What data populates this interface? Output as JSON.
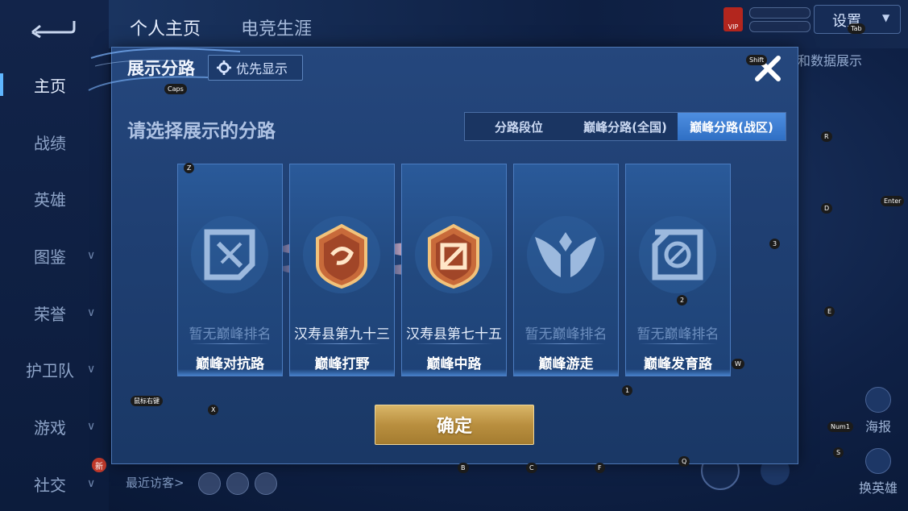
{
  "sidebar": {
    "items": [
      {
        "label": "主页",
        "chevron": false
      },
      {
        "label": "战绩",
        "chevron": false
      },
      {
        "label": "英雄",
        "chevron": false
      },
      {
        "label": "图鉴",
        "chevron": true
      },
      {
        "label": "荣誉",
        "chevron": true
      },
      {
        "label": "护卫队",
        "chevron": true
      },
      {
        "label": "游戏",
        "chevron": true
      },
      {
        "label": "社交",
        "chevron": true
      }
    ],
    "new_badge": "新"
  },
  "top_tabs": [
    "个人主页",
    "电竞生涯"
  ],
  "header": {
    "vip_label": "VIP",
    "settings_label": "设置"
  },
  "right_panel": {
    "label": "和数据展示",
    "poster_label": "海报",
    "swap_label": "换英雄"
  },
  "recent_visitors": "最近访客>",
  "dialog": {
    "title": "展示分路",
    "priority_label": "优先显示",
    "subtitle": "请选择展示的分路",
    "segments": [
      "分路段位",
      "巅峰分路(全国)",
      "巅峰分路(战区)"
    ],
    "active_segment": 2,
    "cards": [
      {
        "rank": "暂无巅峰排名",
        "role": "巅峰对抗路",
        "ranked": false,
        "icon": "lane-top-icon"
      },
      {
        "rank": "汉寿县第九十三",
        "role": "巅峰打野",
        "ranked": true,
        "icon": "lane-jungle-badge-icon"
      },
      {
        "rank": "汉寿县第七十五",
        "role": "巅峰中路",
        "ranked": true,
        "icon": "lane-mid-badge-icon"
      },
      {
        "rank": "暂无巅峰排名",
        "role": "巅峰游走",
        "ranked": false,
        "icon": "lane-support-icon"
      },
      {
        "rank": "暂无巅峰排名",
        "role": "巅峰发育路",
        "ranked": false,
        "icon": "lane-bottom-icon"
      }
    ],
    "confirm_label": "确定"
  },
  "key_hints": {
    "caps": "Caps",
    "shift": "Shift",
    "tab": "Tab",
    "r": "R",
    "enter": "Enter",
    "d": "D",
    "three": "3",
    "e": "E",
    "two": "2",
    "w": "W",
    "one": "1",
    "z": "Z",
    "x": "X",
    "num1": "Num1",
    "s": "S",
    "b": "B",
    "c": "C",
    "f": "F",
    "q": "Q",
    "mouse": "鼠标右键"
  }
}
